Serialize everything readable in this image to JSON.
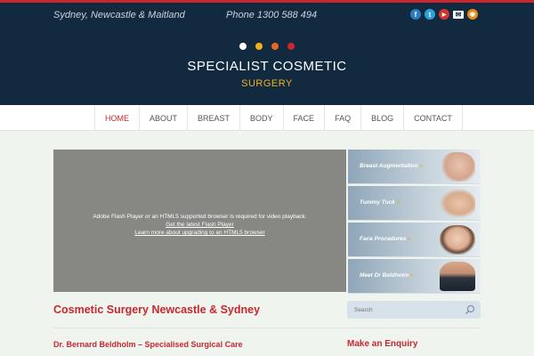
{
  "header": {
    "location": "Sydney, Newcastle & Maitland",
    "phone": "Phone 1300 588 494",
    "social": [
      {
        "icon": "facebook-icon",
        "glyph": "f",
        "color": "#2a7bbf"
      },
      {
        "icon": "twitter-icon",
        "glyph": "t",
        "color": "#2aa3d8"
      },
      {
        "icon": "youtube-icon",
        "glyph": "▶",
        "color": "#d0342c"
      },
      {
        "icon": "email-icon",
        "glyph": "✉",
        "color": "#ffffff"
      },
      {
        "icon": "rss-icon",
        "glyph": "◉",
        "color": "#e88a1a"
      }
    ],
    "dots": [
      "#ffffff",
      "#f2b01e",
      "#e46a24",
      "#c8282e"
    ],
    "brand_line1": "SPECIALIST COSMETIC",
    "brand_line2": "SURGERY"
  },
  "nav": {
    "items": [
      "HOME",
      "ABOUT",
      "BREAST",
      "BODY",
      "FACE",
      "FAQ",
      "BLOG",
      "CONTACT"
    ],
    "active": "HOME"
  },
  "video": {
    "message": "Adobe Flash Player or an HTML5 supported browser is required for video playback.",
    "link1": "Get the latest Flash Player",
    "link2": "Learn more about upgrading to an HTML5 browser"
  },
  "promos": [
    {
      "label": "Breast Augmentation",
      "arrow": "»"
    },
    {
      "label": "Tummy Tuck",
      "arrow": "»"
    },
    {
      "label": "Face Procedures",
      "arrow": "»"
    },
    {
      "label": "Meet Dr Beldholm",
      "arrow": "»"
    }
  ],
  "main": {
    "heading": "Cosmetic Surgery Newcastle & Sydney",
    "subheading": "Dr. Bernard Beldholm – Specialised Surgical Care"
  },
  "sidebar": {
    "search_placeholder": "Search",
    "enquiry_title": "Make an Enquiry"
  },
  "colors": {
    "accent": "#c8282e",
    "header_bg": "#112a40",
    "gold": "#f2b01e"
  }
}
